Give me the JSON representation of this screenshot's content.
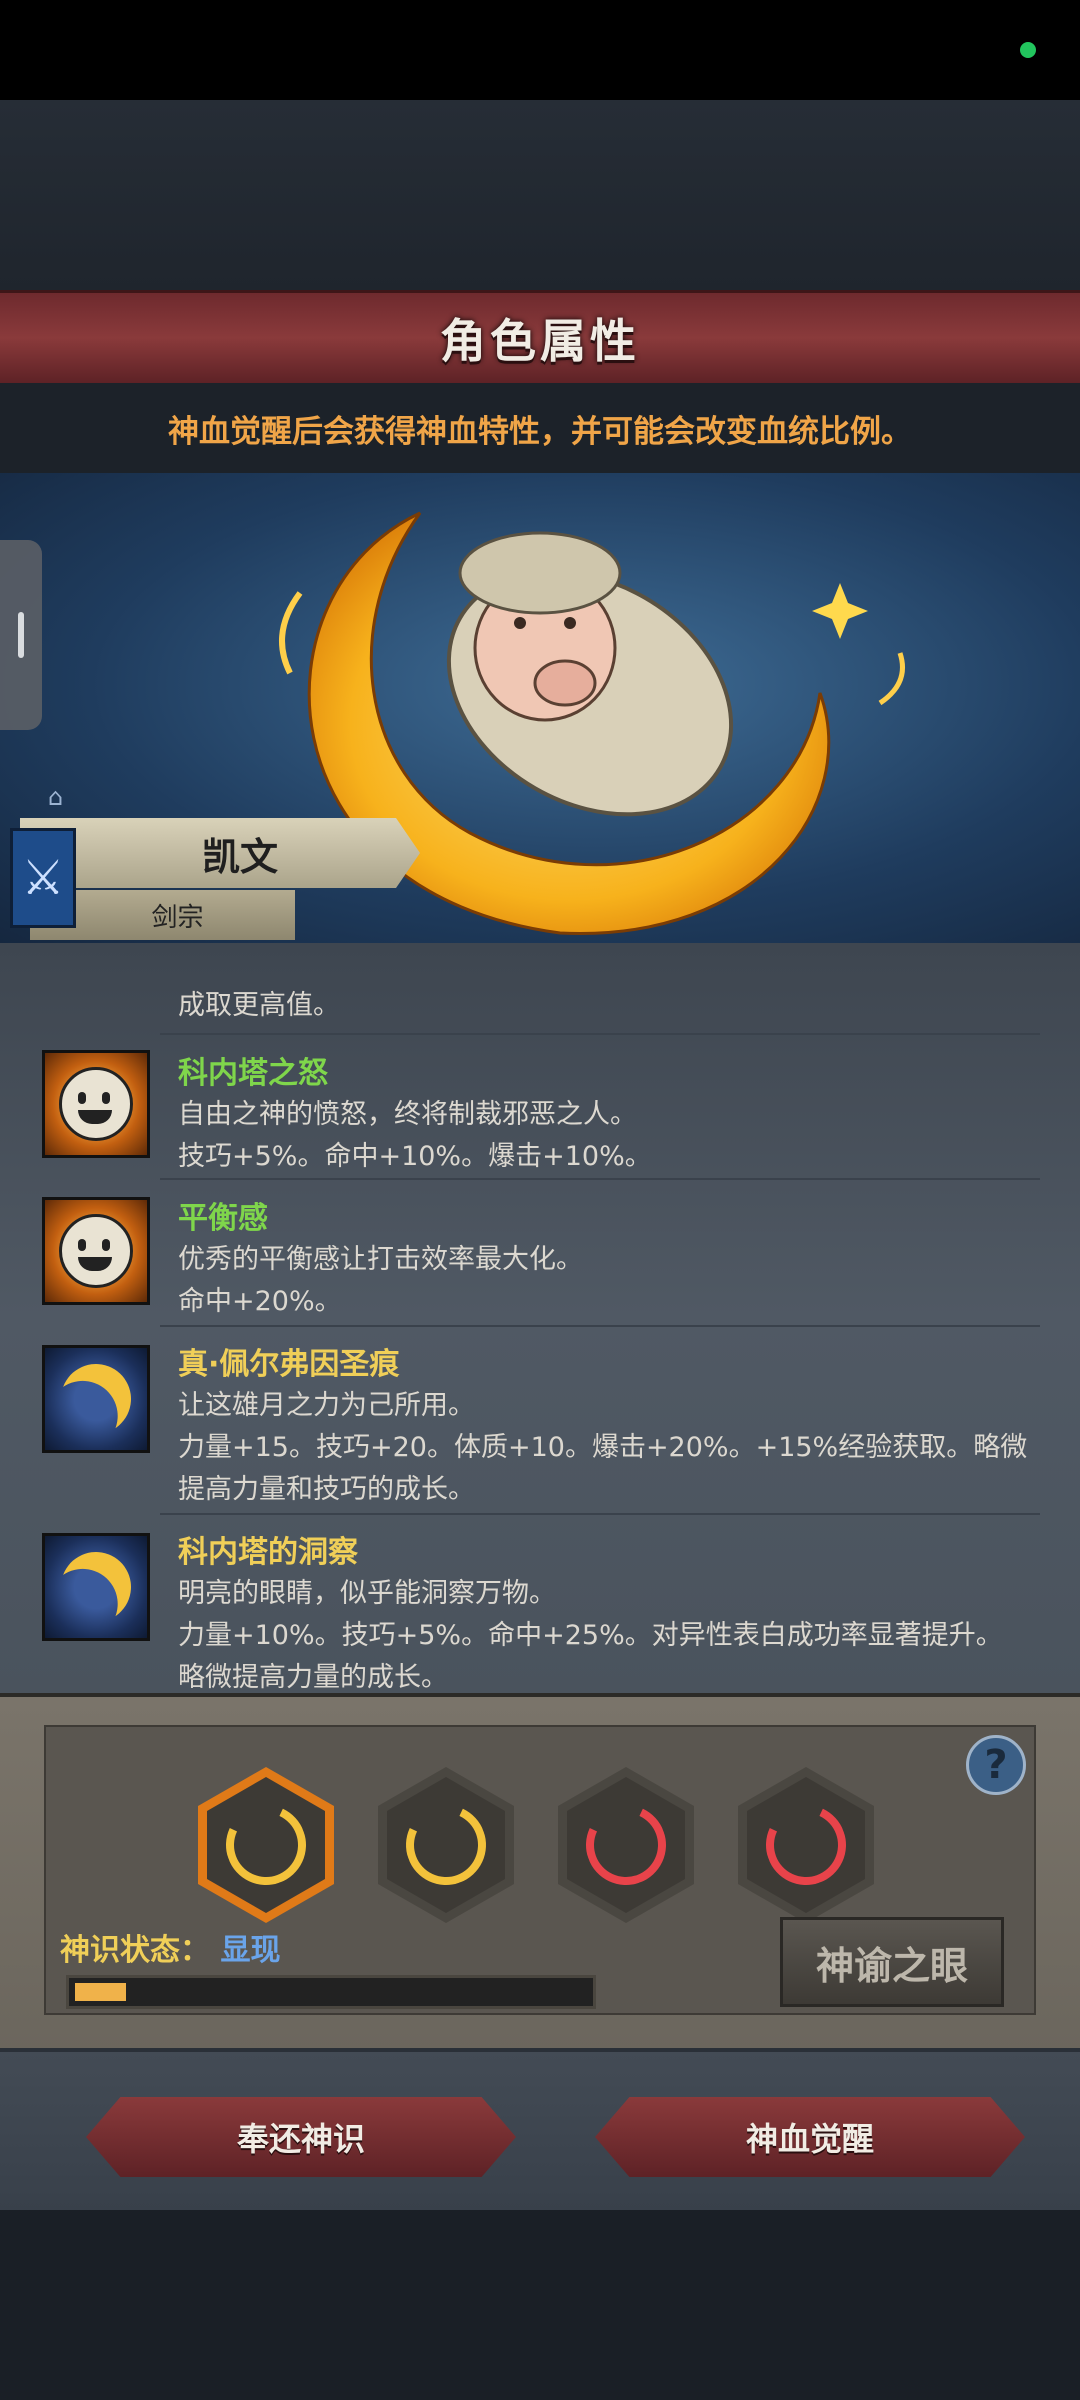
{
  "header": {
    "title": "角色属性",
    "notice": "神血觉醒后会获得神血特性，并可能会改变血统比例。"
  },
  "character": {
    "name": "凯文",
    "class": "剑宗"
  },
  "traits": {
    "partial": {
      "line1": "成取更高值。"
    },
    "items": [
      {
        "name": "科内塔之怒",
        "icon": "sun-face-icon",
        "lines": [
          "自由之神的愤怒，终将制裁邪恶之人。",
          "技巧+5%。命中+10%。爆击+10%。"
        ]
      },
      {
        "name": "平衡感",
        "icon": "sun-face-icon",
        "lines": [
          "优秀的平衡感让打击效率最大化。",
          "命中+20%。"
        ]
      },
      {
        "name": "真·佩尔弗因圣痕",
        "icon": "crescent-moon-icon",
        "lines": [
          "让这雄月之力为己所用。",
          "力量+15。技巧+20。体质+10。爆击+20%。+15%经验获取。略微",
          "提高力量和技巧的成长。"
        ]
      },
      {
        "name": "科内塔的洞察",
        "icon": "crescent-moon-icon",
        "lines": [
          "明亮的眼睛，似乎能洞察万物。",
          "力量+10%。技巧+5%。命中+25%。对异性表白成功率显著提升。",
          "略微提高力量的成长。"
        ]
      }
    ]
  },
  "divine_panel": {
    "state_label": "神识状态：",
    "state_value": "显现",
    "progress": 0.1,
    "eye_button": "神谕之眼",
    "help_icon": "question-icon",
    "slots": [
      {
        "color": "#f3c23b",
        "active": true
      },
      {
        "color": "#f3c23b",
        "active": false
      },
      {
        "color": "#e8434a",
        "active": false
      },
      {
        "color": "#e8434a",
        "active": false
      }
    ]
  },
  "actions": {
    "return_label": "奉还神识",
    "awaken_label": "神血觉醒"
  }
}
